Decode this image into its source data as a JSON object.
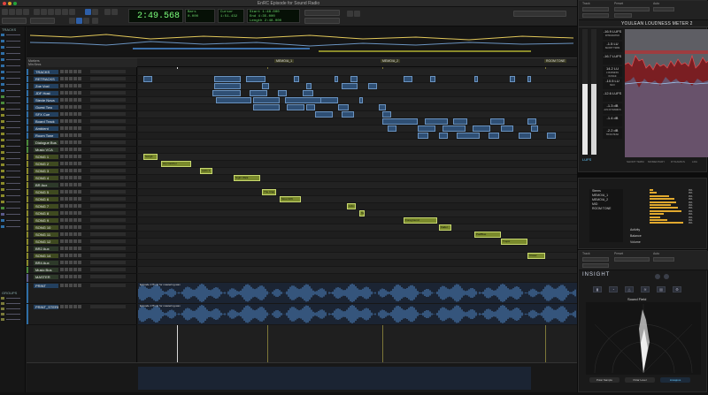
{
  "window": {
    "title": "EnRC Episode for Sound Radio"
  },
  "transport": {
    "main_counter": "2:49.568",
    "sub_counter_label": "Bars",
    "sub_counter": "0.000",
    "readout_labels": [
      "Start",
      "End",
      "Length"
    ],
    "readout_values": [
      "1:48.000",
      "4:35.000",
      "2:48.000"
    ],
    "preroll_label": "Pre-roll",
    "postroll_label": "Post-roll",
    "grid_label": "GRID",
    "nudge_label": "NUDGE",
    "cursor_label": "Cursor",
    "cursor_value": "1:51.432",
    "tempo": "120"
  },
  "track_list": {
    "header": "TRACKS"
  },
  "groups": {
    "header": "GROUPS"
  },
  "rulers": {
    "markers": [
      "MEMO/A_1",
      "MEMO/A_2",
      "ROOM TONE"
    ],
    "header_label": "Markers",
    "ruler_label": "Min:Secs"
  },
  "tracks": [
    {
      "name": "TRACKS",
      "color": "#2e6ea6",
      "type": "folder"
    },
    {
      "name": "RETRACKS",
      "color": "#2e6ea6",
      "type": "audio"
    },
    {
      "name": "Zoe Voxl",
      "color": "#2e6ea6",
      "type": "audio"
    },
    {
      "name": "JDF Host",
      "color": "#2e6ea6",
      "type": "audio"
    },
    {
      "name": "Stevie Nova",
      "color": "#2e6ea6",
      "type": "audio"
    },
    {
      "name": "Guest Two",
      "color": "#2e6ea6",
      "type": "audio"
    },
    {
      "name": "SFX Cue",
      "color": "#2e6ea6",
      "type": "audio"
    },
    {
      "name": "Board Track",
      "color": "#2e6ea6",
      "type": "audio"
    },
    {
      "name": "Ambient",
      "color": "#2e6ea6",
      "type": "audio"
    },
    {
      "name": "Room Tone",
      "color": "#2e6ea6",
      "type": "audio"
    },
    {
      "name": "Dialogue Bus",
      "color": "#4a8a3a",
      "type": "aux"
    },
    {
      "name": "Music VCA",
      "color": "#4a8a3a",
      "type": "vca"
    },
    {
      "name": "SONG 1",
      "color": "#8a8a2a",
      "type": "audio"
    },
    {
      "name": "SONG 2",
      "color": "#8a8a2a",
      "type": "audio"
    },
    {
      "name": "SONG 3",
      "color": "#8a8a2a",
      "type": "audio"
    },
    {
      "name": "SONG 4",
      "color": "#8a8a2a",
      "type": "audio"
    },
    {
      "name": "BR Aux",
      "color": "#8a8a2a",
      "type": "aux"
    },
    {
      "name": "SONG 5",
      "color": "#8a8a2a",
      "type": "audio"
    },
    {
      "name": "SONG 6",
      "color": "#8a8a2a",
      "type": "audio"
    },
    {
      "name": "SONG 7",
      "color": "#8a8a2a",
      "type": "audio"
    },
    {
      "name": "SONG 8",
      "color": "#8a8a2a",
      "type": "audio"
    },
    {
      "name": "SONG 9",
      "color": "#8a8a2a",
      "type": "audio"
    },
    {
      "name": "SONG 10",
      "color": "#8a8a2a",
      "type": "audio"
    },
    {
      "name": "SONG 11",
      "color": "#8a8a2a",
      "type": "audio"
    },
    {
      "name": "SONG 12",
      "color": "#8a8a2a",
      "type": "audio"
    },
    {
      "name": "BR2 Aux",
      "color": "#8a8a2a",
      "type": "aux"
    },
    {
      "name": "SONG 14",
      "color": "#8a8a2a",
      "type": "audio"
    },
    {
      "name": "BR4 Aux",
      "color": "#8a8a2a",
      "type": "aux"
    },
    {
      "name": "Music Bus",
      "color": "#4a8a3a",
      "type": "aux"
    },
    {
      "name": "MASTER",
      "color": "#5a5a8a",
      "type": "master"
    },
    {
      "name": "PRINT",
      "color": "#2e6ea6",
      "type": "audio"
    },
    {
      "name": "PRINT_STEREO",
      "color": "#2e6ea6",
      "type": "audio"
    }
  ],
  "music_clips": [
    {
      "label": "Song1"
    },
    {
      "label": "Hip Catcher"
    },
    {
      "label": "Lado 1"
    },
    {
      "label": "Night Walk"
    },
    {
      "label": "The Clap"
    },
    {
      "label": "Slow Drift"
    },
    {
      "label": "Lido 2"
    },
    {
      "label": "Tag"
    },
    {
      "label": "Foreground"
    },
    {
      "label": "Fader"
    },
    {
      "label": "PadBlue"
    },
    {
      "label": "Tropic"
    },
    {
      "label": "Closer"
    }
  ],
  "print_clips": [
    "Episode 175 (1) for mastering.wav",
    "Episode 175 (1) for mastering.wav"
  ],
  "youlean": {
    "window_title": "Track",
    "preset_label": "Preset",
    "auto_label": "Auto",
    "plugin_name": "YOULEAN LOUDNESS METER 2",
    "integrated": "-16.9 LUFS",
    "integrated_label": "INTEGRATED",
    "short_term": "-1.5 LU",
    "short_term_label": "SHORT TERM",
    "momentary": "-16.7 LUFS",
    "range": "14.2 LU",
    "range_label": "LOUDNESS RANGE",
    "true_peak": "-10.5 LU",
    "max_label": "MAX",
    "sp": "-12.6 LUFS",
    "avg": "-1.3 dB",
    "avg_label": "AVG DYNAMICS",
    "max_m": "-1.4 dB",
    "tp": "-2.2 dB",
    "tp_label": "TRUE PEAK",
    "scale_unit": "LUFS",
    "footer": [
      "SHORT TERM",
      "MOMENTARY",
      "DYNAMICS",
      "LRA"
    ]
  },
  "tracer": {
    "list_title": "Stems",
    "items": [
      "MEMO/A_1",
      "MEMO/A_2",
      "MID",
      "ROOM TONE"
    ],
    "bars": [
      {
        "value": "0%",
        "fill": 0.1
      },
      {
        "value": "0%",
        "fill": 0.2
      },
      {
        "value": "0%",
        "fill": 0.55
      },
      {
        "value": "0%",
        "fill": 0.7
      },
      {
        "value": "0%",
        "fill": 0.75
      },
      {
        "value": "0%",
        "fill": 0.6
      },
      {
        "value": "0%",
        "fill": 0.8
      },
      {
        "value": "0%",
        "fill": 0.9
      },
      {
        "value": "0%",
        "fill": 0.4
      },
      {
        "value": "0%",
        "fill": 0.3
      },
      {
        "value": "0%",
        "fill": 0.5
      },
      {
        "value": "0%",
        "fill": 0.95
      }
    ],
    "activity_label": "Activity",
    "balance_label": "Balance",
    "volume_label": "Volume"
  },
  "insight": {
    "window_title": "Track",
    "preset_label": "Preset",
    "auto_label": "Auto",
    "brand": "INSIGHT",
    "sound_field_title": "Sound Field",
    "buttons": [
      "Polar Sample",
      "Polar Level",
      "Lissajous"
    ]
  },
  "colors": {
    "accent_blue": "#6a93c0",
    "accent_green": "#7cff7c",
    "music_clip": "#7a8a2c",
    "youlean_red": "#c82828",
    "tracer_bar": "#e0a82e"
  }
}
